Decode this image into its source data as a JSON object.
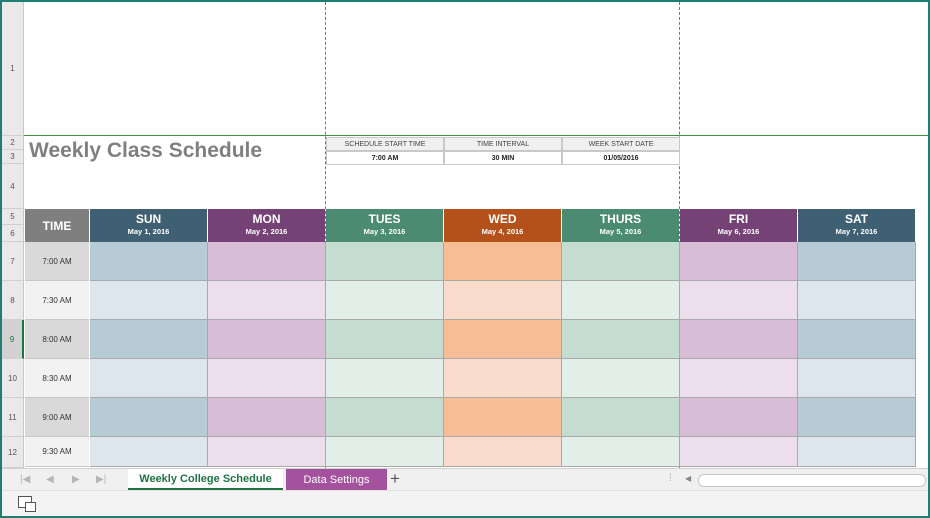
{
  "title": "Weekly Class Schedule",
  "params": {
    "start_time_label": "SCHEDULE START TIME",
    "start_time_value": "7:00 AM",
    "interval_label": "TIME INTERVAL",
    "interval_value": "30 MIN",
    "week_start_label": "WEEK START DATE",
    "week_start_value": "01/05/2016"
  },
  "time_header": "TIME",
  "days": [
    {
      "name": "SUN",
      "date": "May 1, 2016",
      "header_color": "#3f5f72",
      "dark": "#b7cbd5",
      "light": "#dce6ec"
    },
    {
      "name": "MON",
      "date": "May 2, 2016",
      "header_color": "#754275",
      "dark": "#d8bdd7",
      "light": "#ecdeec"
    },
    {
      "name": "TUES",
      "date": "May 3, 2016",
      "header_color": "#4a8b71",
      "dark": "#c4ddd0",
      "light": "#e2eee8"
    },
    {
      "name": "WED",
      "date": "May 4, 2016",
      "header_color": "#b4501a",
      "dark": "#f7bd97",
      "light": "#f9dccb"
    },
    {
      "name": "THURS",
      "date": "May 5, 2016",
      "header_color": "#4a8b71",
      "dark": "#c4ddd0",
      "light": "#e2eee8"
    },
    {
      "name": "FRI",
      "date": "May 6, 2016",
      "header_color": "#754275",
      "dark": "#d8bdd7",
      "light": "#ecdeec"
    },
    {
      "name": "SAT",
      "date": "May 7, 2016",
      "header_color": "#3f5f72",
      "dark": "#b7cbd5",
      "light": "#dce6ec"
    }
  ],
  "times": [
    "7:00 AM",
    "7:30 AM",
    "8:00 AM",
    "8:30 AM",
    "9:00 AM",
    "9:30 AM"
  ],
  "row_numbers": [
    "1",
    "2",
    "3",
    "4",
    "5",
    "6",
    "7",
    "8",
    "9",
    "10",
    "11",
    "12"
  ],
  "sheet_tabs": {
    "active": "Weekly College Schedule",
    "other": "Data Settings",
    "add": "+"
  },
  "nav_icons": [
    "first-sheet-icon",
    "prev-sheet-icon",
    "next-sheet-icon",
    "last-sheet-icon"
  ],
  "colors": {
    "time_header": "#7f7f7f",
    "time_dark": "#d9d9d9",
    "time_light": "#f2f2f2",
    "accent": "#217346",
    "tab_other": "#a4519e"
  }
}
